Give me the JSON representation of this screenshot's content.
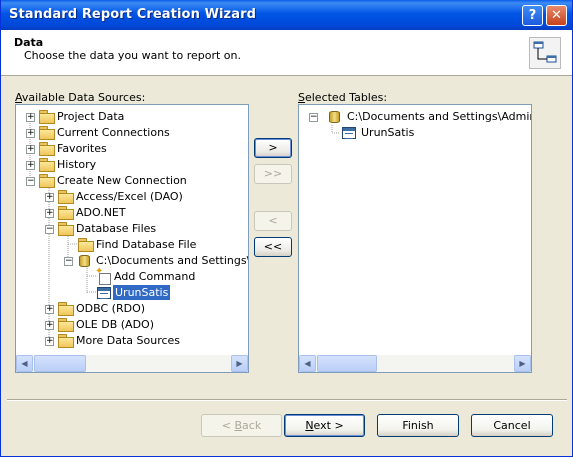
{
  "window": {
    "title": "Standard Report Creation Wizard",
    "help_glyph": "?",
    "close_glyph": "✕"
  },
  "header": {
    "title": "Data",
    "subtitle": "Choose the data you want to report on."
  },
  "left": {
    "label_u": "A",
    "label_rest": "vailable Data Sources:",
    "tree": [
      {
        "label": "Project Data",
        "expander": "+",
        "icon": "folder-icon"
      },
      {
        "label": "Current Connections",
        "expander": "+",
        "icon": "folder-icon"
      },
      {
        "label": "Favorites",
        "expander": "+",
        "icon": "folder-icon"
      },
      {
        "label": "History",
        "expander": "+",
        "icon": "folder-icon"
      },
      {
        "label": "Create New Connection",
        "expander": "−",
        "icon": "folder-icon"
      },
      {
        "label": "Access/Excel (DAO)",
        "expander": "+",
        "icon": "folder-icon"
      },
      {
        "label": "ADO.NET",
        "expander": "+",
        "icon": "folder-icon"
      },
      {
        "label": "Database Files",
        "expander": "−",
        "icon": "folder-icon"
      },
      {
        "label": "Find Database File",
        "expander": "",
        "icon": "folder-icon"
      },
      {
        "label": "C:\\Documents and Settings\\Adr",
        "expander": "−",
        "icon": "database-icon"
      },
      {
        "label": "Add Command",
        "expander": "",
        "icon": "add-command-icon"
      },
      {
        "label": "UrunSatis",
        "expander": "",
        "icon": "table-icon"
      },
      {
        "label": "ODBC (RDO)",
        "expander": "+",
        "icon": "folder-icon"
      },
      {
        "label": "OLE DB (ADO)",
        "expander": "+",
        "icon": "folder-icon"
      },
      {
        "label": "More Data Sources",
        "expander": "+",
        "icon": "folder-icon"
      }
    ]
  },
  "middle": {
    "add": ">",
    "add_all": ">>",
    "remove": "<",
    "remove_all": "<<"
  },
  "right": {
    "label_u": "S",
    "label_rest": "elected Tables:",
    "tree": [
      {
        "label": "C:\\Documents and Settings\\Administra",
        "expander": "−",
        "icon": "database-icon"
      },
      {
        "label": "UrunSatis",
        "expander": "",
        "icon": "table-icon"
      }
    ]
  },
  "scroll": {
    "left_arrow": "◀",
    "right_arrow": "▶"
  },
  "footer": {
    "back_prefix": "< ",
    "back_u": "B",
    "back_rest": "ack",
    "next_u": "N",
    "next_rest": "ext >",
    "finish": "Finish",
    "cancel": "Cancel"
  }
}
